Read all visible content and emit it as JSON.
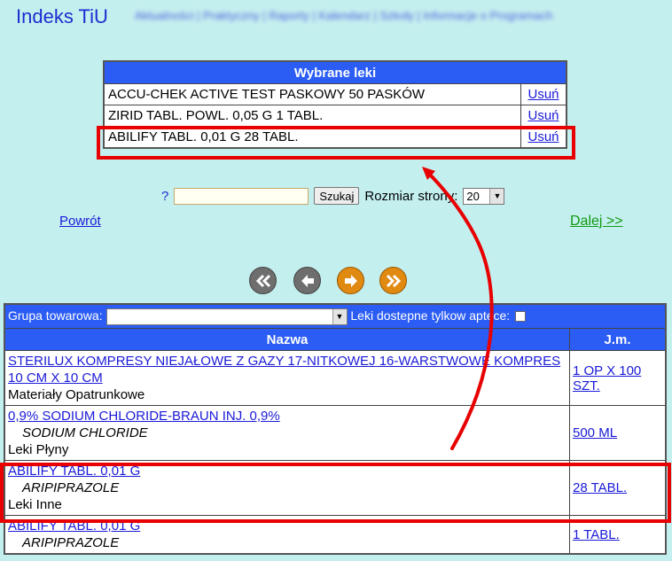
{
  "header": {
    "title": "Indeks TiU",
    "nav_blurred": "Aktualności | Praktyczny | Raporty | Kalendarz | Szkoły | Informacje o Programach"
  },
  "selected_drugs": {
    "title": "Wybrane leki",
    "remove_label": "Usuń",
    "items": [
      {
        "name": "ACCU-CHEK ACTIVE TEST PASKOWY 50 PASKÓW"
      },
      {
        "name": "ZIRID TABL. POWL. 0,05 G 1 TABL."
      },
      {
        "name": "ABILIFY TABL. 0,01 G 28 TABL."
      }
    ]
  },
  "search": {
    "prefix": "?",
    "value": "",
    "button_label": "Szukaj",
    "page_size_label": "Rozmiar strony:",
    "page_size_value": "20"
  },
  "navigation": {
    "back_label": "Powrót",
    "next_label": "Dalej >>"
  },
  "results": {
    "group_filter_label": "Grupa towarowa:",
    "group_filter_value": "",
    "available_only_label": "Leki dostepne tylkow aptece:",
    "available_only_checked": false,
    "columns": [
      "Nazwa",
      "J.m."
    ],
    "rows": [
      {
        "name": "STERILUX KOMPRESY NIEJAŁOWE Z GAZY 17-NITKOWEJ 16-WARSTWOWE KOMPRES 10 CM X 10 CM",
        "substance": "",
        "group": "Materiały Opatrunkowe",
        "unit": "1 OP X 100 SZT."
      },
      {
        "name": "0,9% SODIUM CHLORIDE-BRAUN INJ. 0,9%",
        "substance": "SODIUM CHLORIDE",
        "group": "Leki Płyny",
        "unit": "500 ML"
      },
      {
        "name": "ABILIFY TABL. 0,01 G",
        "substance": "ARIPIPRAZOLE",
        "group": "Leki Inne",
        "unit": "28 TABL."
      },
      {
        "name": "ABILIFY TABL. 0,01 G",
        "substance": "ARIPIPRAZOLE",
        "group": "",
        "unit": "1 TABL."
      }
    ]
  },
  "colors": {
    "background": "#c4efef",
    "header_blue": "#2b5df5",
    "title_blue": "#1a2fd0",
    "next_green": "#109a10",
    "highlight_red": "#e80000",
    "pager_orange": "#e08a12",
    "pager_grey": "#6e6e6e"
  },
  "icons": [
    "first-page-icon",
    "previous-page-icon",
    "next-page-icon",
    "last-page-icon",
    "dropdown-arrow-icon"
  ]
}
